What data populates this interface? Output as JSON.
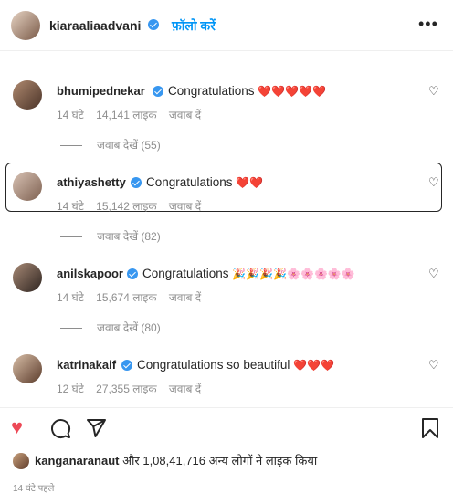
{
  "header": {
    "username": "kiaraaliaadvani",
    "follow_label": "फ़ॉलो करें",
    "more_label": "•••"
  },
  "comments": [
    {
      "username": "bhumipednekar",
      "text": "Congratulations",
      "emojis": "❤️❤️❤️❤️❤️",
      "time": "14 घंटे",
      "likes": "14,141 लाइक",
      "reply": "जवाब दें",
      "view_replies": "जवाब देखें (55)"
    },
    {
      "username": "athiyashetty",
      "text": "Congratulations",
      "emojis": "❤️❤️",
      "time": "14 घंटे",
      "likes": "15,142 लाइक",
      "reply": "जवाब दें",
      "view_replies": "जवाब देखें (82)"
    },
    {
      "username": "anilskapoor",
      "text": "Congratulations",
      "emojis": "🎉🎉🎉🎉🌸🌸🌸🌸🌸",
      "time": "14 घंटे",
      "likes": "15,674 लाइक",
      "reply": "जवाब दें",
      "view_replies": "जवाब देखें (80)"
    },
    {
      "username": "katrinakaif",
      "text": "Congratulations so beautiful",
      "emojis": "❤️❤️❤️",
      "time": "12 घंटे",
      "likes": "27,355 लाइक",
      "reply": "जवाब दें"
    }
  ],
  "likes_summary": {
    "liked_by": "kanganaranaut",
    "rest": "और 1,08,41,716 अन्य लोगों ने लाइक किया"
  },
  "post_time": "14 घंटे पहले",
  "icons": {
    "like": "heart-icon",
    "comment": "comment-icon",
    "share": "share-icon",
    "save": "bookmark-icon"
  }
}
